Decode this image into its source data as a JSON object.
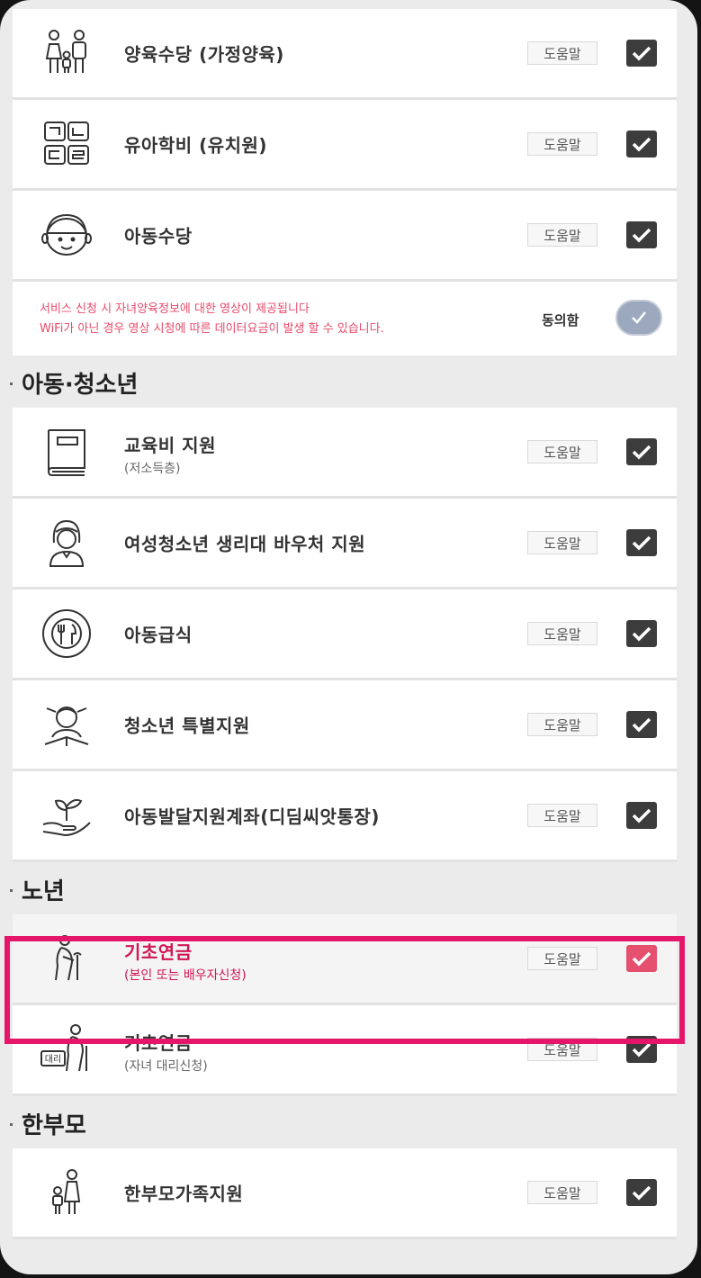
{
  "help_label": "도움말",
  "notice": {
    "line1": "서비스 신청 시 자녀양육정보에 대한 영상이 제공됩니다",
    "line2": "WiFi가 아닌 경우 영상 시청에 따른 데이터요금이 발생 할 수 있습니다.",
    "agree_label": "동의함"
  },
  "sections": {
    "youth": "아동·청소년",
    "elderly": "노년",
    "single_parent": "한부모"
  },
  "items": {
    "home_care": {
      "title": "양육수당 (가정양육)",
      "icon": "family-icon",
      "checked": true
    },
    "kindergarten": {
      "title": "유아학비 (유치원)",
      "icon": "blocks-icon",
      "checked": true
    },
    "child_allowance": {
      "title": "아동수당",
      "icon": "child-face-icon",
      "checked": true
    },
    "education": {
      "title": "교육비 지원",
      "sub": "(저소득층)",
      "icon": "book-icon",
      "checked": true
    },
    "sanitary": {
      "title": "여성청소년 생리대 바우처 지원",
      "icon": "girl-icon",
      "checked": true
    },
    "meals": {
      "title": "아동급식",
      "icon": "plate-icon",
      "checked": true
    },
    "teen_support": {
      "title": "청소년 특별지원",
      "icon": "teen-reading-icon",
      "checked": true
    },
    "dream_account": {
      "title": "아동발달지원계좌(디딤씨앗통장)",
      "icon": "sprout-hand-icon",
      "checked": true
    },
    "pension_self": {
      "title": "기초연금",
      "sub": "(본인 또는 배우자신청)",
      "icon": "elderly-icon",
      "checked": true
    },
    "pension_proxy": {
      "title": "기초연금",
      "sub": "(자녀 대리신청)",
      "icon": "elderly-proxy-icon",
      "proxy_tag": "대리",
      "checked": true
    },
    "single_parent_support": {
      "title": "한부모가족지원",
      "icon": "parent-child-icon",
      "checked": true
    }
  },
  "colors": {
    "accent": "#e5166a",
    "notice_text": "#e94a6a",
    "checkbox": "#3c3c3c"
  }
}
